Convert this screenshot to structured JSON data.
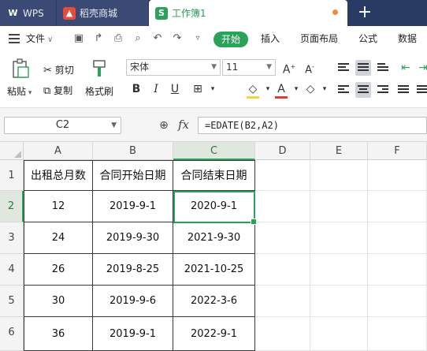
{
  "tabs": [
    {
      "label": "WPS"
    },
    {
      "label": "稻壳商城"
    },
    {
      "label": "工作簿1"
    }
  ],
  "menu": {
    "file": "文件",
    "start": "开始",
    "insert": "插入",
    "page_layout": "页面布局",
    "formula": "公式",
    "data": "数据"
  },
  "ribbon": {
    "paste": "粘贴",
    "cut": "剪切",
    "copy": "复制",
    "format_painter": "格式刷",
    "font_name": "宋体",
    "font_size": "11"
  },
  "formula_bar": {
    "name_box": "C2",
    "fx": "fx",
    "formula": "=EDATE(B2,A2)"
  },
  "grid": {
    "columns": [
      "A",
      "B",
      "C",
      "D",
      "E",
      "F"
    ],
    "rows": [
      "1",
      "2",
      "3",
      "4",
      "5",
      "6"
    ],
    "header": [
      "出租总月数",
      "合同开始日期",
      "合同结束日期"
    ],
    "data": [
      [
        "12",
        "2019-9-1",
        "2020-9-1"
      ],
      [
        "24",
        "2019-9-30",
        "2021-9-30"
      ],
      [
        "26",
        "2019-8-25",
        "2021-10-25"
      ],
      [
        "30",
        "2019-9-6",
        "2022-3-6"
      ],
      [
        "36",
        "2019-9-1",
        "2022-9-1"
      ]
    ],
    "selected_cell": "C2"
  },
  "colors": {
    "accent": "#2ba25a",
    "titlebar": "#2a3b63"
  }
}
